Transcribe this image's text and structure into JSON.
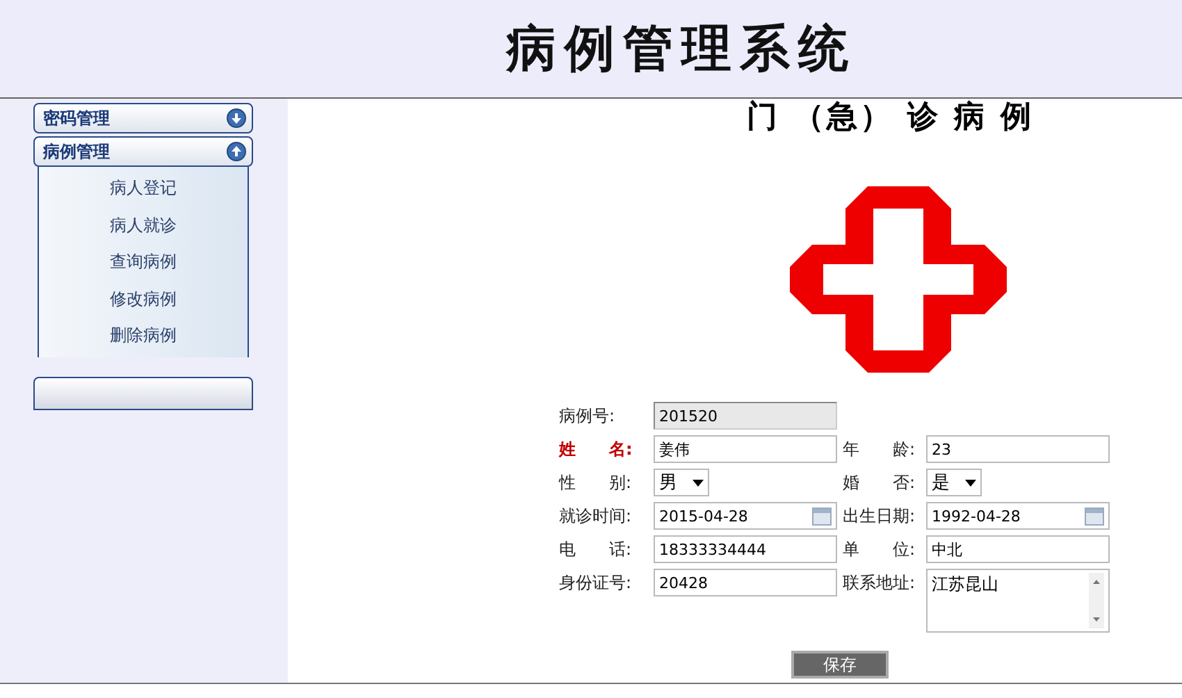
{
  "header": {
    "title": "病例管理系统"
  },
  "sidebar": {
    "sections": [
      {
        "label": "密码管理",
        "expanded": false
      },
      {
        "label": "病例管理",
        "expanded": true,
        "items": [
          "病人登记",
          "病人就诊",
          "查询病例",
          "修改病例",
          "删除病例"
        ]
      }
    ]
  },
  "form": {
    "title": "门 （急） 诊 病 例",
    "fields": [
      {
        "label": "病例号:",
        "kind": "readonly",
        "value": "201520",
        "required": false
      },
      {
        "label": "姓　　名:",
        "kind": "text",
        "value": "姜伟",
        "required": true
      },
      {
        "label": "年　　龄:",
        "kind": "text",
        "value": "23",
        "required": false
      },
      {
        "label": "性　　别:",
        "kind": "select",
        "value": "男",
        "required": false
      },
      {
        "label": "婚　　否:",
        "kind": "select",
        "value": "是",
        "required": false
      },
      {
        "label": "就诊时间:",
        "kind": "date",
        "value": "2015-04-28",
        "required": false
      },
      {
        "label": "出生日期:",
        "kind": "date",
        "value": "1992-04-28",
        "required": false
      },
      {
        "label": "电　　话:",
        "kind": "text",
        "value": "18333334444",
        "required": false
      },
      {
        "label": "单　　位:",
        "kind": "text",
        "value": "中北",
        "required": false
      },
      {
        "label": "身份证号:",
        "kind": "text",
        "value": "20428",
        "required": false
      },
      {
        "label": "联系地址:",
        "kind": "textarea",
        "value": "江苏昆山",
        "required": false
      }
    ],
    "save_button": "保存"
  }
}
